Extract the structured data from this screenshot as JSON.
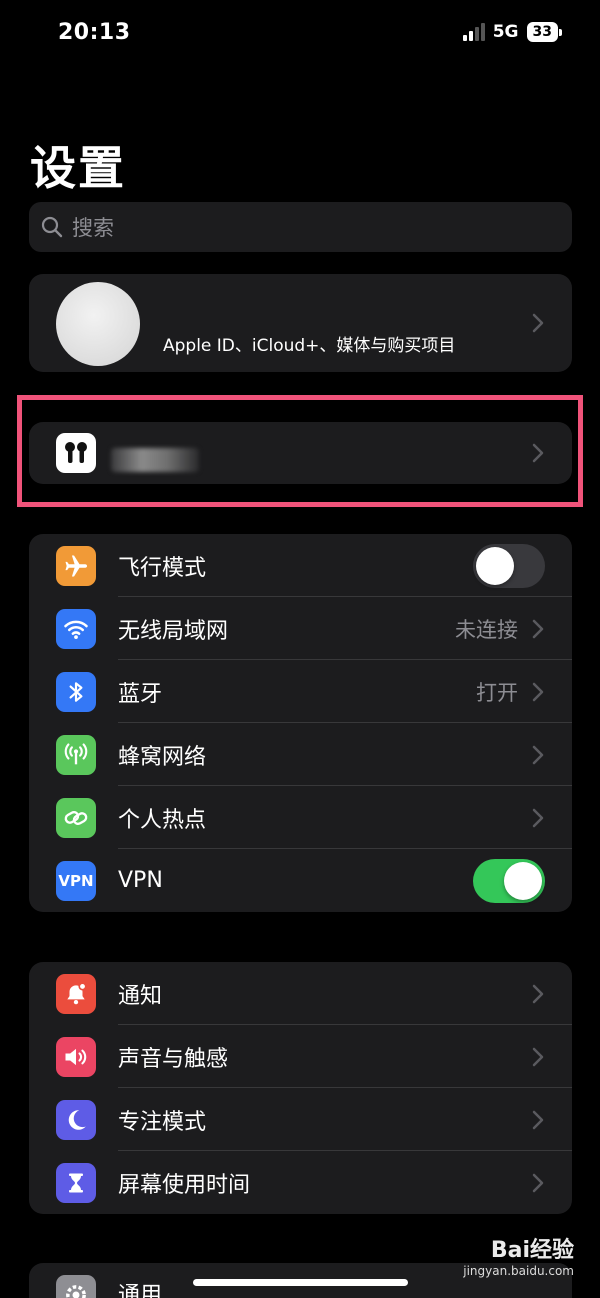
{
  "status": {
    "time": "20:13",
    "network": "5G",
    "battery": "33"
  },
  "page_title": "设置",
  "search": {
    "placeholder": "搜索"
  },
  "profile": {
    "subtitle": "Apple ID、iCloud+、媒体与购买项目"
  },
  "group1": [
    {
      "label": "飞行模式",
      "icon": "airplane-icon",
      "color": "#f19a37",
      "toggle": "off"
    },
    {
      "label": "无线局域网",
      "icon": "wifi-icon",
      "color": "#3478f6",
      "value": "未连接"
    },
    {
      "label": "蓝牙",
      "icon": "bluetooth-icon",
      "color": "#3478f6",
      "value": "打开"
    },
    {
      "label": "蜂窝网络",
      "icon": "cellular-icon",
      "color": "#5ac75c"
    },
    {
      "label": "个人热点",
      "icon": "hotspot-icon",
      "color": "#5ac75c"
    },
    {
      "label": "VPN",
      "icon": "vpn-icon",
      "icon_text": "VPN",
      "color": "#3478f6",
      "toggle": "on"
    }
  ],
  "group2": [
    {
      "label": "通知",
      "icon": "notification-icon",
      "color": "#eb4d3d"
    },
    {
      "label": "声音与触感",
      "icon": "sound-icon",
      "color": "#eb4563"
    },
    {
      "label": "专注模式",
      "icon": "moon-icon",
      "color": "#5e5ce6"
    },
    {
      "label": "屏幕使用时间",
      "icon": "hourglass-icon",
      "color": "#5e5ce6"
    }
  ],
  "group3": [
    {
      "label": "通用",
      "icon": "gear-icon",
      "color": "#8e8e93"
    }
  ],
  "watermark": {
    "brand": "Bai经验",
    "url": "jingyan.baidu.com"
  }
}
